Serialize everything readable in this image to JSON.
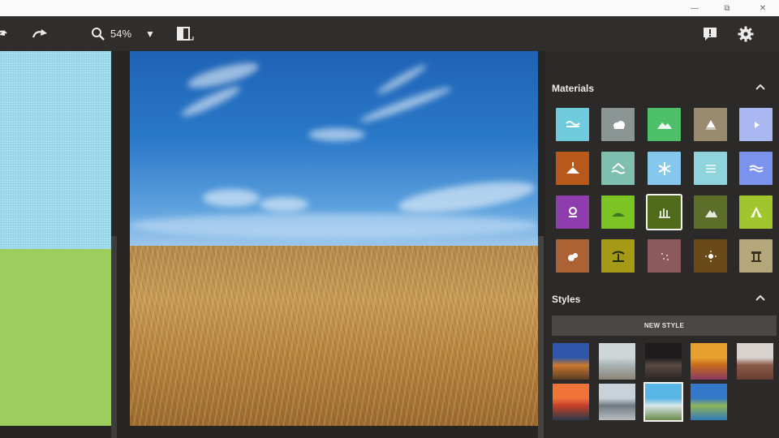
{
  "titlebar": {
    "minimize_glyph": "—",
    "restore_glyph": "⧉",
    "close_glyph": "✕"
  },
  "toolbar": {
    "zoom_value": "54%",
    "zoom_dropdown_glyph": "▼"
  },
  "panel": {
    "materials_title": "Materials",
    "styles_title": "Styles",
    "new_style_label": "NEW STYLE",
    "materials": [
      {
        "icon": "wave-water-icon",
        "color": "#6fcbdc"
      },
      {
        "icon": "cloud-icon",
        "color": "#8a9594"
      },
      {
        "icon": "hill-icon",
        "color": "#4fc06a"
      },
      {
        "icon": "volcano-icon",
        "color": "#9a8a70"
      },
      {
        "icon": "play-icon",
        "color": "#a9b8f0"
      },
      {
        "icon": "eruption-icon",
        "color": "#b8581a"
      },
      {
        "icon": "house-flood-icon",
        "color": "#7fbfb0"
      },
      {
        "icon": "snowflake-icon",
        "color": "#86c7ee"
      },
      {
        "icon": "fog-lines-icon",
        "color": "#8fd3dd"
      },
      {
        "icon": "wave-lines-icon",
        "color": "#7b93ec"
      },
      {
        "icon": "flower-icon",
        "color": "#8d3dad"
      },
      {
        "icon": "grass-hill-icon",
        "color": "#7cc324"
      },
      {
        "icon": "grass-icon",
        "color": "#4f6b1a"
      },
      {
        "icon": "mountain-peak-icon",
        "color": "#5d6e2a"
      },
      {
        "icon": "tent-icon",
        "color": "#a0c52d"
      },
      {
        "icon": "rock-icon",
        "color": "#ad6236"
      },
      {
        "icon": "palm-tree-icon",
        "color": "#a59a16"
      },
      {
        "icon": "sparkle-dots-icon",
        "color": "#8d5a5c"
      },
      {
        "icon": "sun-burst-icon",
        "color": "#6b4a1a"
      },
      {
        "icon": "temple-icon",
        "color": "#b5a779"
      }
    ],
    "selected_material_index": 12,
    "styles": [
      {
        "sky": "#2f56a8",
        "mid": "#c9782e",
        "ground": "#5a3d24"
      },
      {
        "sky": "#cfd6d8",
        "mid": "#a8b3b5",
        "ground": "#8c8476"
      },
      {
        "sky": "#1d1b1c",
        "mid": "#5a4a44",
        "ground": "#2a2624"
      },
      {
        "sky": "#e8a12e",
        "mid": "#c76a1e",
        "ground": "#8a3a62"
      },
      {
        "sky": "#d9d3cf",
        "mid": "#8a5a48",
        "ground": "#6a3e34"
      },
      {
        "sky": "#f0733a",
        "mid": "#c8402a",
        "ground": "#2a3a48"
      },
      {
        "sky": "#c9d2d8",
        "mid": "#6f7a80",
        "ground": "#b8bec2"
      },
      {
        "sky": "#57b6e6",
        "mid": "#d8e6e8",
        "ground": "#6a8a4a"
      },
      {
        "sky": "#3478c9",
        "mid": "#8fb45a",
        "ground": "#2f7ab8"
      }
    ],
    "selected_style_index": 7
  }
}
